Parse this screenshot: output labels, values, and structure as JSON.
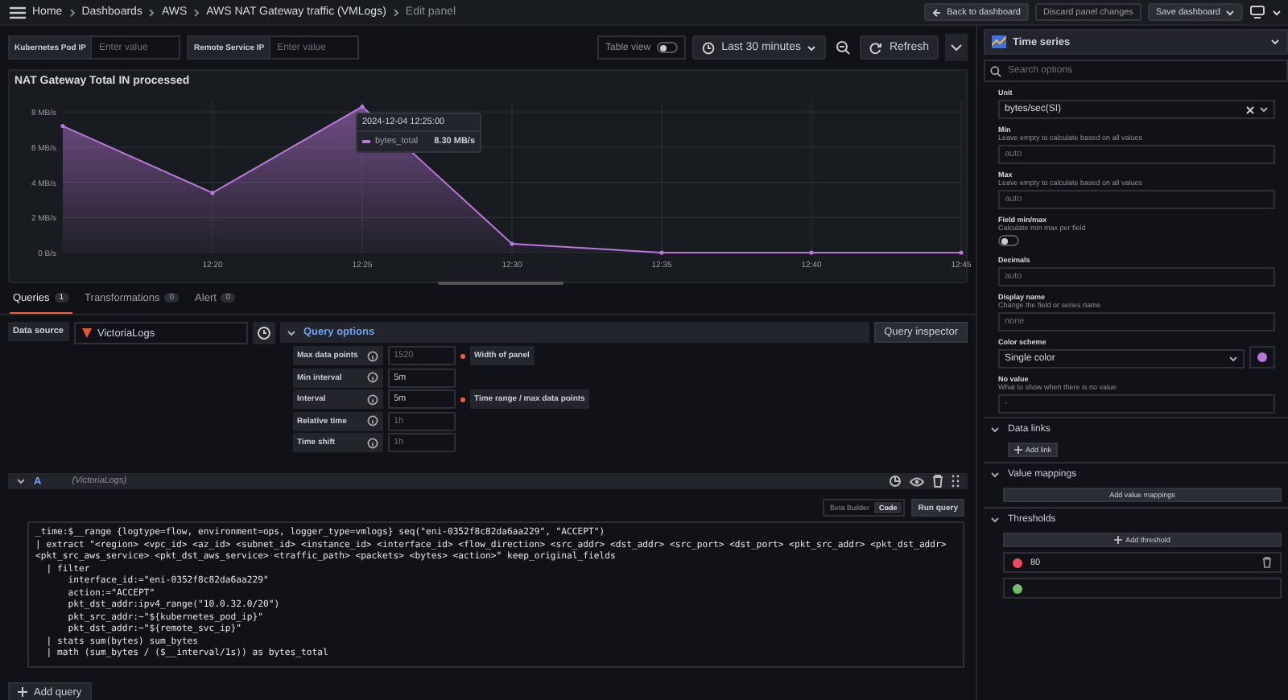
{
  "breadcrumbs": [
    "Home",
    "Dashboards",
    "AWS",
    "AWS NAT Gateway traffic (VMLogs)",
    "Edit panel"
  ],
  "top_actions": {
    "back": "Back to dashboard",
    "discard": "Discard panel changes",
    "save": "Save dashboard"
  },
  "variables": [
    {
      "label": "Kubernetes Pod IP",
      "placeholder": "Enter value"
    },
    {
      "label": "Remote Service IP",
      "placeholder": "Enter value"
    }
  ],
  "toolbar": {
    "table_view": {
      "label": "Table view",
      "on": false
    },
    "time_range": "Last 30 minutes",
    "refresh": "Refresh"
  },
  "panel": {
    "title": "NAT Gateway Total IN processed",
    "chart_data": {
      "type": "area",
      "categories": [
        null,
        "12:20",
        "12:25",
        "12:30",
        "12:35",
        "12:40",
        "12:45"
      ],
      "series": [
        {
          "name": "bytes_total",
          "color": "#b877d9",
          "values": [
            7.2,
            3.4,
            8.3,
            0.5,
            0,
            0,
            0
          ]
        }
      ],
      "ylim": [
        0,
        8.6
      ],
      "grid": true,
      "yticks": [
        {
          "value": 0,
          "label": "0 B/s"
        },
        {
          "value": 2,
          "label": "2 MB/s"
        },
        {
          "value": 4,
          "label": "4 MB/s"
        },
        {
          "value": 6,
          "label": "6 MB/s"
        },
        {
          "value": 8,
          "label": "8 MB/s"
        }
      ]
    },
    "tooltip": {
      "time": "2024-12-04 12:25:00",
      "value": "8.30 MB/s"
    }
  },
  "tabs": [
    {
      "label": "Queries",
      "count": "1",
      "selected": true
    },
    {
      "label": "Transformations",
      "count": "0",
      "selected": false
    },
    {
      "label": "Alert",
      "count": "0",
      "selected": false
    }
  ],
  "data_source": {
    "label": "Data source",
    "value": "VictoriaLogs"
  },
  "query_options": {
    "title": "Query options",
    "expanded": true,
    "inspector": "Query inspector",
    "rows": [
      {
        "label": "Max data points",
        "placeholder": "1520",
        "note": "Width of panel"
      },
      {
        "label": "Min interval",
        "value": "5m"
      },
      {
        "label": "Interval",
        "value": "5m",
        "note": "Time range / max data points"
      },
      {
        "label": "Relative time",
        "placeholder": "1h"
      },
      {
        "label": "Time shift",
        "placeholder": "1h"
      }
    ]
  },
  "query": {
    "ref": "A",
    "source": "(VictoriaLogs)",
    "expanded": true,
    "modes": [
      {
        "label": "Beta Builder",
        "selected": false
      },
      {
        "label": "Code",
        "selected": true
      }
    ],
    "run": "Run query",
    "code": [
      "_time:$__range {logtype=flow, environment=ops, logger_type=vmlogs} seq(\"eni-0352f8c82da6aa229\", \"ACCEPT\")",
      "| extract \"<region> <vpc_id> <az_id> <subnet_id> <instance_id> <interface_id> <flow_direction> <src_addr> <dst_addr> <src_port> <dst_port> <pkt_src_addr> <pkt_dst_addr> <pkt_src_aws_service> <pkt_dst_aws_service> <traffic_path> <packets> <bytes> <action>\" keep_original_fields",
      "  | filter",
      "      interface_id:=\"eni-0352f8c82da6aa229\"",
      "      action:=\"ACCEPT\"",
      "      pkt_dst_addr:ipv4_range(\"10.0.32.0/20\")",
      "      pkt_src_addr:~\"${kubernetes_pod_ip}\"",
      "      pkt_dst_addr:~\"${remote_svc_ip}\"",
      "  | stats sum(bytes) sum_bytes",
      "  | math (sum_bytes / ($__interval/1s)) as bytes_total"
    ]
  },
  "add_query": "Add query",
  "visualization": "Time series",
  "search": {
    "placeholder": "Search options"
  },
  "options": [
    {
      "kind": "select",
      "label": "Unit",
      "value": "bytes/sec(SI)"
    },
    {
      "kind": "input",
      "label": "Min",
      "description": "Leave empty to calculate based on all values",
      "placeholder": "auto"
    },
    {
      "kind": "input",
      "label": "Max",
      "description": "Leave empty to calculate based on all values",
      "placeholder": "auto"
    },
    {
      "kind": "switch",
      "label": "Field min/max",
      "description": "Calculate min max per field",
      "on": false
    },
    {
      "kind": "input",
      "label": "Decimals",
      "placeholder": "auto"
    },
    {
      "kind": "input",
      "label": "Display name",
      "description": "Change the field or series name",
      "placeholder": "none"
    },
    {
      "kind": "color_select",
      "label": "Color scheme",
      "value": "Single color",
      "color": "#b877d9"
    },
    {
      "kind": "input",
      "label": "No value",
      "description": "What to show when there is no value",
      "placeholder": "-"
    }
  ],
  "sections": [
    {
      "title": "Data links",
      "expanded": true,
      "action": "Add link",
      "kind": "small"
    },
    {
      "title": "Value mappings",
      "expanded": true,
      "action": "Add value mappings",
      "kind": "wide"
    },
    {
      "title": "Thresholds",
      "expanded": true,
      "action": "Add threshold",
      "kind": "wide",
      "thresholds": [
        {
          "value": "80",
          "color": "#f2495c"
        },
        {
          "color": "#73bf69"
        }
      ]
    }
  ]
}
